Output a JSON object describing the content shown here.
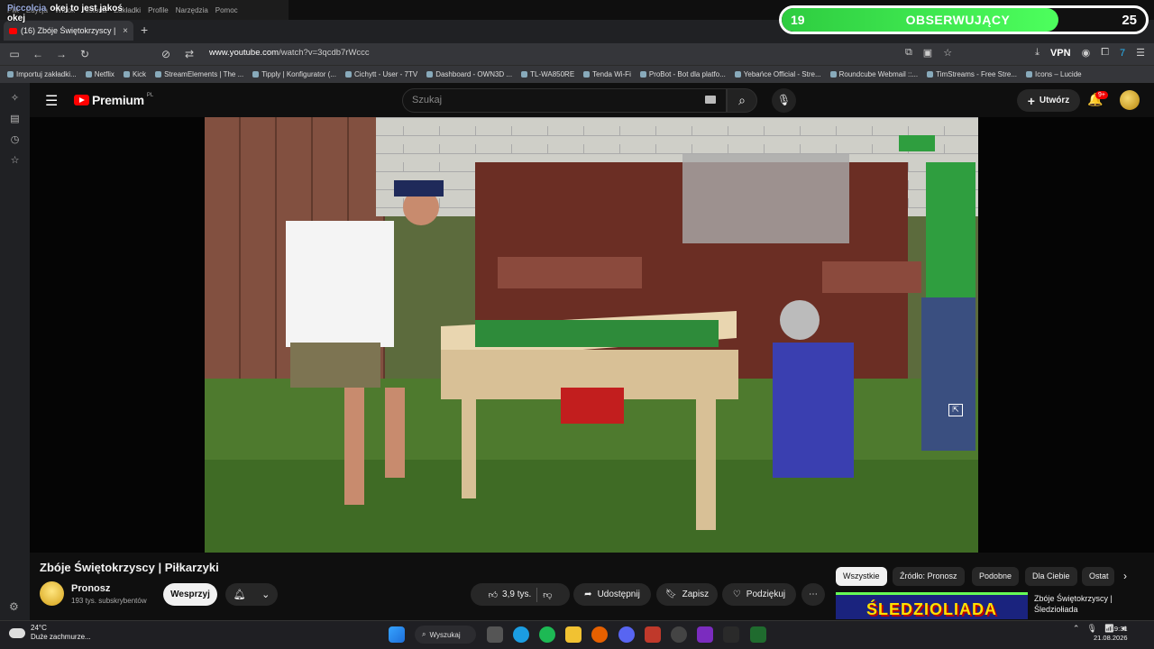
{
  "browser": {
    "menu": [
      "Plik",
      "Edycja",
      "Widok",
      "Historia",
      "Zakładki",
      "Profile",
      "Narzędzia",
      "Pomoc"
    ],
    "chat_overlay": {
      "user": "Piccolcia",
      "message": "okej to jest jakoś okej"
    },
    "tab_title": "(16) Zbóje Świętokrzyscy | Piłka",
    "tab_close": "×",
    "new_tab": "+",
    "url_host": "www.youtube.com",
    "url_path": "/watch?v=3qcdb7rWccc",
    "vpn_label": "VPN",
    "bookmarks": [
      "Importuj zakładki...",
      "Netflix",
      "Kick",
      "StreamElements | The ...",
      "Tipply | Konfigurator (...",
      "Cichytt - User - 7TV",
      "Dashboard - OWN3D ...",
      "TL-WA850RE",
      "Tenda Wi-Fi",
      "ProBot - Bot dla platfo...",
      "Yebańce Official - Stre...",
      "Roundcube Webmail ::...",
      "TimStreams - Free Stre...",
      "Icons – Lucide"
    ]
  },
  "follow_goal": {
    "current": "19",
    "label": "OBSERWUJĄCY",
    "target": "25",
    "progress": 0.76
  },
  "youtube": {
    "logo_text": "Premium",
    "logo_region": "PL",
    "search_placeholder": "Szukaj",
    "create_label": "Utwórz",
    "notif_count": "9+"
  },
  "video": {
    "title": "Zbóje Świętokrzyscy | Piłkarzyki",
    "channel": "Pronosz",
    "subs": "193 tys. subskrybentów",
    "join_label": "Wesprzyj",
    "likes": "3,9 tys.",
    "share_label": "Udostępnij",
    "save_label": "Zapisz",
    "thanks_label": "Podziękuj",
    "more_label": "⋯"
  },
  "chips": [
    "Wszystkie",
    "Źródło: Pronosz",
    "Podobne",
    "Dla Ciebie",
    "Ostat"
  ],
  "related": {
    "thumb_text": "ŚLEDZIOLIADA",
    "title": "Zbóje Świętokrzyscy | Śledziołiada"
  },
  "taskbar": {
    "temp": "24°C",
    "weather": "Duże zachmurze...",
    "search_label": "Wyszukaj",
    "time": "19:31",
    "date": "21.08.2026"
  },
  "colors": {
    "accent": "#ff0000",
    "goal_green": "#2ecc40",
    "bg": "#0f0f0f"
  }
}
